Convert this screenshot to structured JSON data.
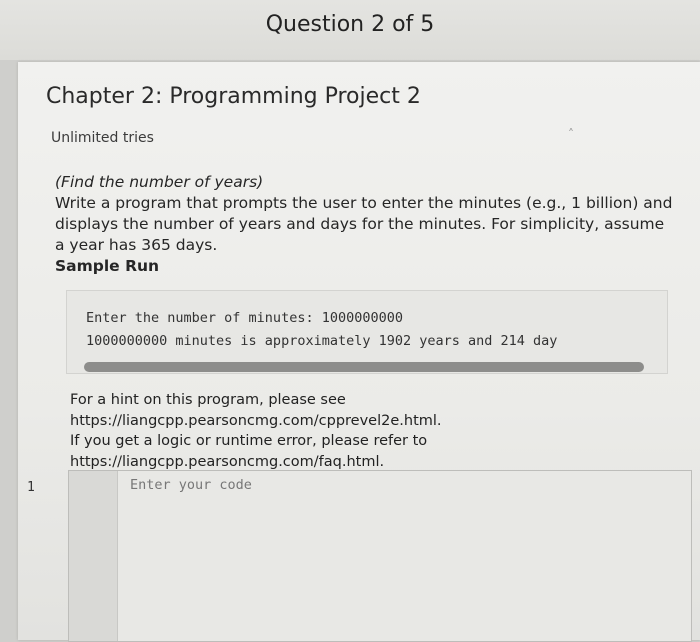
{
  "header": {
    "question_counter": "Question 2 of 5"
  },
  "problem": {
    "title": "Chapter 2: Programming Project 2",
    "tries": "Unlimited tries",
    "heading": "(Find the number of years)",
    "lines": [
      "Write a program that prompts the user to enter the minutes (e.g., 1 billion) and",
      "displays the number of years and days for the minutes. For simplicity, assume",
      "a year has 365 days."
    ],
    "sample_label": "Sample Run"
  },
  "sample_run": {
    "line1": "Enter the number of minutes: 1000000000",
    "line2": "1000000000 minutes is approximately 1902 years and 214 day"
  },
  "hint": {
    "lines": [
      "For a hint on this program, please see",
      "https://liangcpp.pearsoncmg.com/cpprevel2e.html.",
      "If you get a logic or runtime error, please refer to",
      "https://liangcpp.pearsoncmg.com/faq.html."
    ]
  },
  "editor": {
    "line_number": "1",
    "placeholder": "Enter your code"
  }
}
